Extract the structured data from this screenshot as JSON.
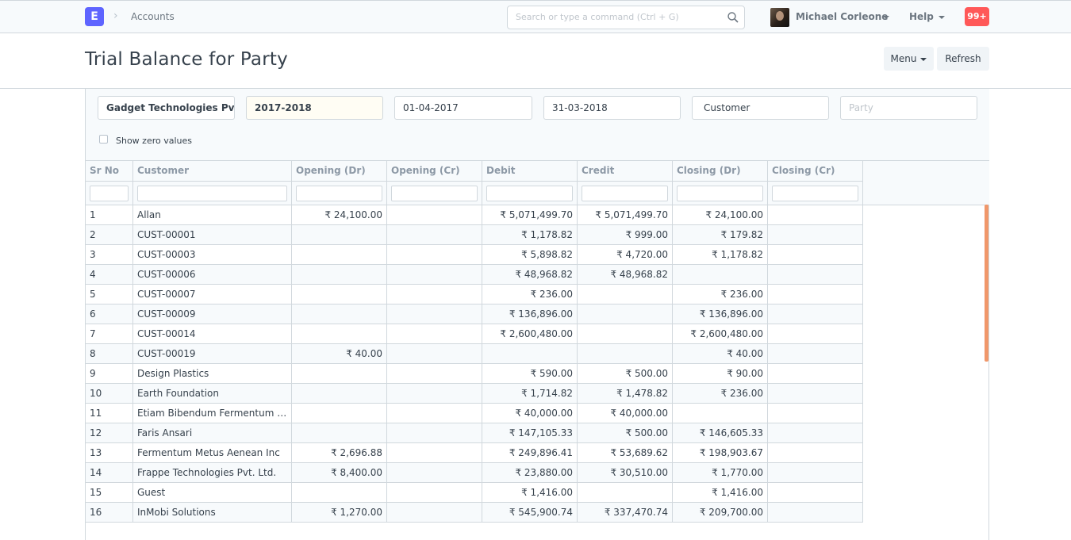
{
  "navbar": {
    "logo_letter": "E",
    "breadcrumb": "Accounts",
    "search_placeholder": "Search or type a command (Ctrl + G)",
    "user_name": "Michael Corleone",
    "help_label": "Help",
    "notifications_count": "99+"
  },
  "page": {
    "title": "Trial Balance for Party",
    "menu_label": "Menu",
    "refresh_label": "Refresh"
  },
  "filters": {
    "company": "Gadget Technologies Pvt. I",
    "fiscal_year": "2017-2018",
    "from_date": "01-04-2017",
    "to_date": "31-03-2018",
    "party_type": "Customer",
    "party_placeholder": "Party",
    "show_zero_values_label": "Show zero values",
    "show_zero_values_checked": false
  },
  "table": {
    "columns": [
      "Sr No",
      "Customer",
      "Opening (Dr)",
      "Opening (Cr)",
      "Debit",
      "Credit",
      "Closing (Dr)",
      "Closing (Cr)"
    ],
    "rows": [
      [
        "1",
        "Allan",
        "₹ 24,100.00",
        "",
        "₹ 5,071,499.70",
        "₹ 5,071,499.70",
        "₹ 24,100.00",
        ""
      ],
      [
        "2",
        "CUST-00001",
        "",
        "",
        "₹ 1,178.82",
        "₹ 999.00",
        "₹ 179.82",
        ""
      ],
      [
        "3",
        "CUST-00003",
        "",
        "",
        "₹ 5,898.82",
        "₹ 4,720.00",
        "₹ 1,178.82",
        ""
      ],
      [
        "4",
        "CUST-00006",
        "",
        "",
        "₹ 48,968.82",
        "₹ 48,968.82",
        "",
        ""
      ],
      [
        "5",
        "CUST-00007",
        "",
        "",
        "₹ 236.00",
        "",
        "₹ 236.00",
        ""
      ],
      [
        "6",
        "CUST-00009",
        "",
        "",
        "₹ 136,896.00",
        "",
        "₹ 136,896.00",
        ""
      ],
      [
        "7",
        "CUST-00014",
        "",
        "",
        "₹ 2,600,480.00",
        "",
        "₹ 2,600,480.00",
        ""
      ],
      [
        "8",
        "CUST-00019",
        "₹ 40.00",
        "",
        "",
        "",
        "₹ 40.00",
        ""
      ],
      [
        "9",
        "Design Plastics",
        "",
        "",
        "₹ 590.00",
        "₹ 500.00",
        "₹ 90.00",
        ""
      ],
      [
        "10",
        "Earth Foundation",
        "",
        "",
        "₹ 1,714.82",
        "₹ 1,478.82",
        "₹ 236.00",
        ""
      ],
      [
        "11",
        "Etiam Bibendum Fermentum Ind...",
        "",
        "",
        "₹ 40,000.00",
        "₹ 40,000.00",
        "",
        ""
      ],
      [
        "12",
        "Faris Ansari",
        "",
        "",
        "₹ 147,105.33",
        "₹ 500.00",
        "₹ 146,605.33",
        ""
      ],
      [
        "13",
        "Fermentum Metus Aenean Inc",
        "₹ 2,696.88",
        "",
        "₹ 249,896.41",
        "₹ 53,689.62",
        "₹ 198,903.67",
        ""
      ],
      [
        "14",
        "Frappe Technologies Pvt. Ltd.",
        "₹ 8,400.00",
        "",
        "₹ 23,880.00",
        "₹ 30,510.00",
        "₹ 1,770.00",
        ""
      ],
      [
        "15",
        "Guest",
        "",
        "",
        "₹ 1,416.00",
        "",
        "₹ 1,416.00",
        ""
      ],
      [
        "16",
        "InMobi Solutions",
        "₹ 1,270.00",
        "",
        "₹ 545,900.74",
        "₹ 337,470.74",
        "₹ 209,700.00",
        ""
      ]
    ]
  },
  "colors": {
    "accent": "#5e64ff",
    "notification": "#ff5858",
    "scrollbar": "#f0976a"
  }
}
